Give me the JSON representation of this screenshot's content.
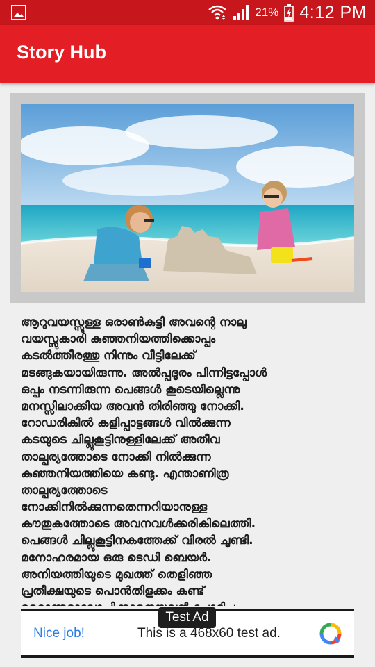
{
  "status_bar": {
    "battery_percent": "21%",
    "time": "4:12 PM",
    "icons": [
      "gallery-icon",
      "wifi-icon",
      "signal-icon",
      "battery-charging-icon"
    ]
  },
  "app_bar": {
    "title": "Story Hub"
  },
  "story": {
    "lines": [
      "ആറുവയസ്സുള്ള ഒരാൺകുട്ടി അവന്റെ നാലു",
      "വയസ്സുകാരി കുഞ്ഞനിയത്തിക്കൊപ്പം",
      "കടൽത്തീരത്തു നിന്നും വീട്ടിലേക്ക്",
      "മടങ്ങുകയായിരുന്നു. അൽപ്പദൂരം പിന്നിട്ടപ്പോൾ",
      "ഒപ്പം നടന്നിരുന്ന പെങ്ങൾ കൂടെയില്ലെന്നു",
      "മനസ്സിലാക്കിയ അവൻ തിരിഞ്ഞു നോക്കി.",
      "റോഡരികിൽ കളിപ്പാട്ടങ്ങൾ വിൽക്കുന്ന",
      "കടയുടെ ചില്ലുകൂട്ടിനുള്ളിലേക്ക് അതീവ",
      "താല്പര്യത്തോടെ നോക്കി നിൽക്കുന്ന",
      "കുഞ്ഞനിയത്തിയെ കണ്ടു. എന്താണിത്ര",
      "താല്പര്യത്തോടെ",
      "നോക്കിനിൽക്കുന്നതെന്നറിയാനുള്ള",
      "കൗതുകത്തോടെ അവനവൾക്കരികിലെത്തി.",
      "പെങ്ങൾ ചില്ലുകൂട്ടിനകത്തേക്ക് വിരൽ ചൂണ്ടി.",
      "മനോഹരമായ ഒരു ടെഡി ബെയർ.",
      "അനിയത്തിയുടെ മുഖത്ത് തെളിഞ്ഞ",
      "പ്രതീക്ഷയുടെ പൊൻതിളക്കം കണ്ട്",
      "മറ്റൊന്നുമാലോചിക്കാതെയവൻ ചോദിച്ചു -"
    ]
  },
  "ad": {
    "label": "Test Ad",
    "nice_text": "Nice job!",
    "description": "This is a 468x60 test ad."
  },
  "colors": {
    "status_bar": "#c8161d",
    "app_bar": "#e31e24",
    "ad_link": "#2b7de9"
  }
}
